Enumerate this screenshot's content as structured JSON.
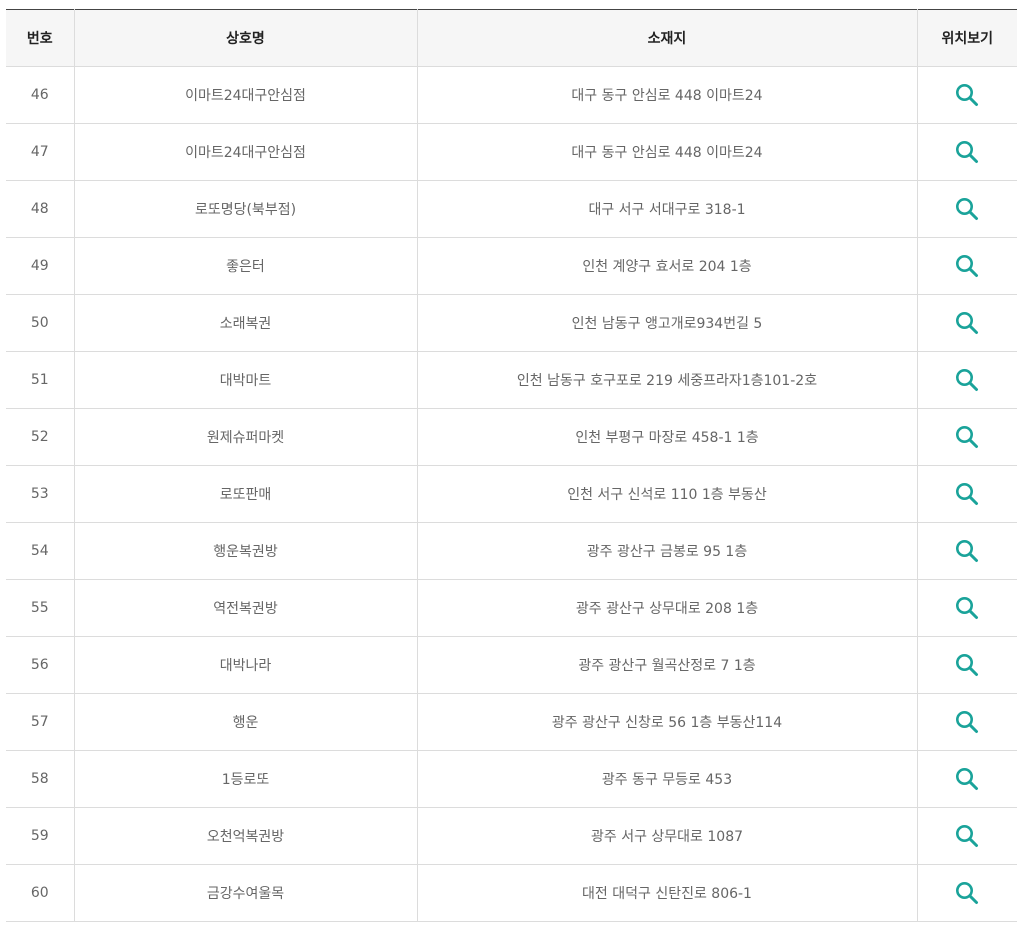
{
  "table": {
    "headers": {
      "no": "번호",
      "name": "상호명",
      "address": "소재지",
      "map": "위치보기"
    },
    "rows": [
      {
        "no": "46",
        "name": "이마트24대구안심점",
        "address": "대구 동구 안심로 448 이마트24"
      },
      {
        "no": "47",
        "name": "이마트24대구안심점",
        "address": "대구 동구 안심로 448 이마트24"
      },
      {
        "no": "48",
        "name": "로또명당(북부점)",
        "address": "대구 서구 서대구로 318-1"
      },
      {
        "no": "49",
        "name": "좋은터",
        "address": "인천 계양구 효서로 204 1층"
      },
      {
        "no": "50",
        "name": "소래복권",
        "address": "인천 남동구 앵고개로934번길 5"
      },
      {
        "no": "51",
        "name": "대박마트",
        "address": "인천 남동구 호구포로 219 세중프라자1층101-2호"
      },
      {
        "no": "52",
        "name": "원제슈퍼마켓",
        "address": "인천 부평구 마장로 458-1 1층"
      },
      {
        "no": "53",
        "name": "로또판매",
        "address": "인천 서구 신석로 110 1층 부동산"
      },
      {
        "no": "54",
        "name": "행운복권방",
        "address": "광주 광산구 금봉로 95 1층"
      },
      {
        "no": "55",
        "name": "역전복권방",
        "address": "광주 광산구 상무대로 208 1층"
      },
      {
        "no": "56",
        "name": "대박나라",
        "address": "광주 광산구 월곡산정로 7 1층"
      },
      {
        "no": "57",
        "name": "행운",
        "address": "광주 광산구 신창로 56 1층 부동산114"
      },
      {
        "no": "58",
        "name": "1등로또",
        "address": "광주 동구 무등로 453"
      },
      {
        "no": "59",
        "name": "오천억복권방",
        "address": "광주 서구 상무대로 1087"
      },
      {
        "no": "60",
        "name": "금강수여울목",
        "address": "대전 대덕구 신탄진로 806-1"
      }
    ]
  },
  "icons": {
    "map_button": "search-icon"
  },
  "colors": {
    "icon": "#1aa39a",
    "header_bg": "#f6f6f6",
    "text": "#666666",
    "border": "#dcdcdc"
  }
}
